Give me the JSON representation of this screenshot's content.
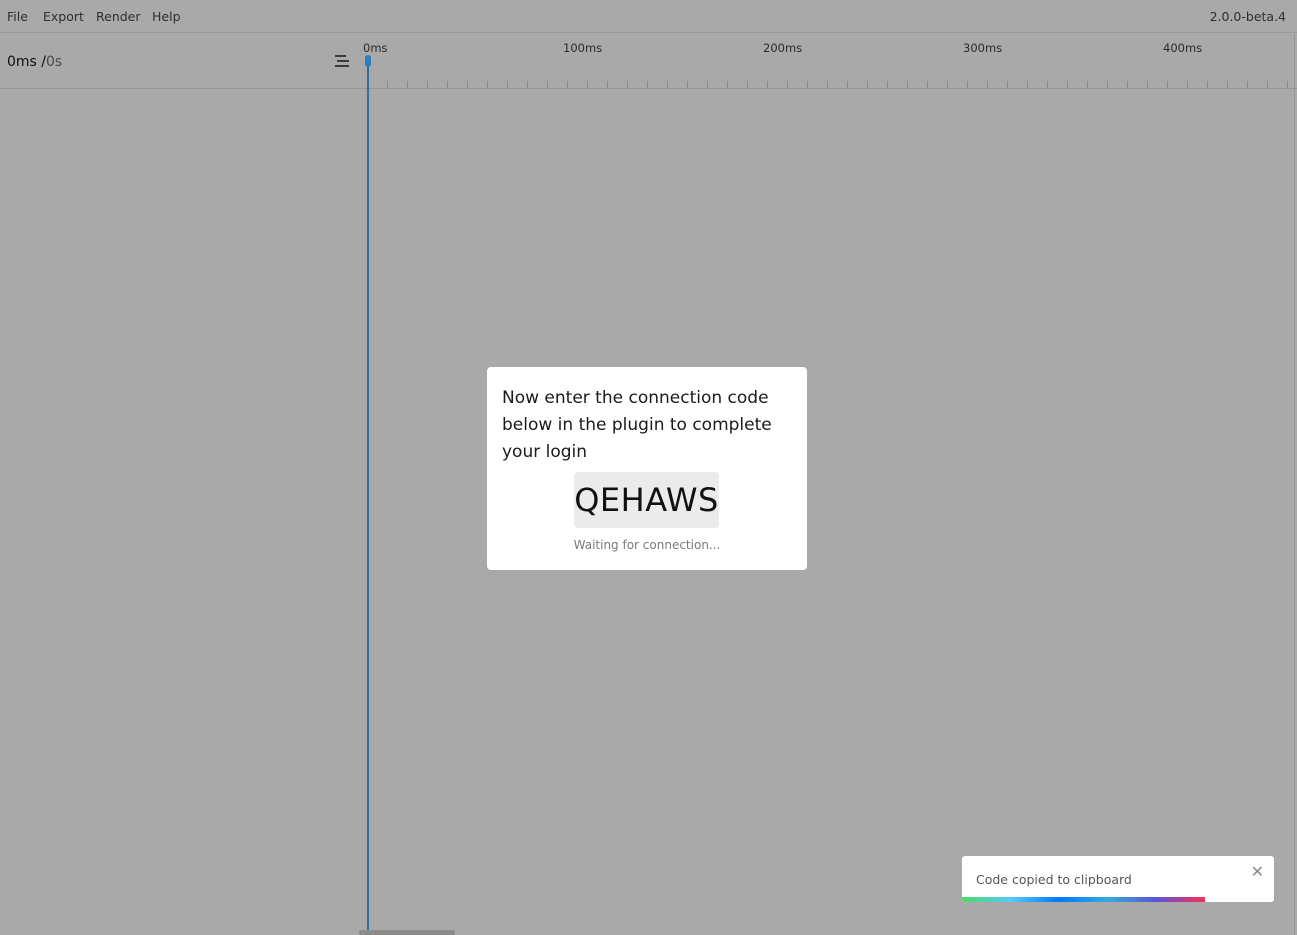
{
  "menubar": {
    "items": [
      "File",
      "Export",
      "Render",
      "Help"
    ],
    "version": "2.0.0-beta.4"
  },
  "timeline": {
    "current_time": "0ms /",
    "total_time": "0s",
    "ruler_labels": [
      "0ms",
      "100ms",
      "200ms",
      "300ms",
      "400ms"
    ]
  },
  "dialog": {
    "message": "Now enter the connection code below in the plugin to complete your login",
    "code": "QEHAWS",
    "status": "Waiting for connection..."
  },
  "toast": {
    "message": "Code copied to clipboard",
    "close_label": "✕",
    "progress_fraction": 0.78
  },
  "colors": {
    "background": "#a9a9a9",
    "playhead": "#2f6f98",
    "playhead_handle": "#2b7fc0"
  }
}
